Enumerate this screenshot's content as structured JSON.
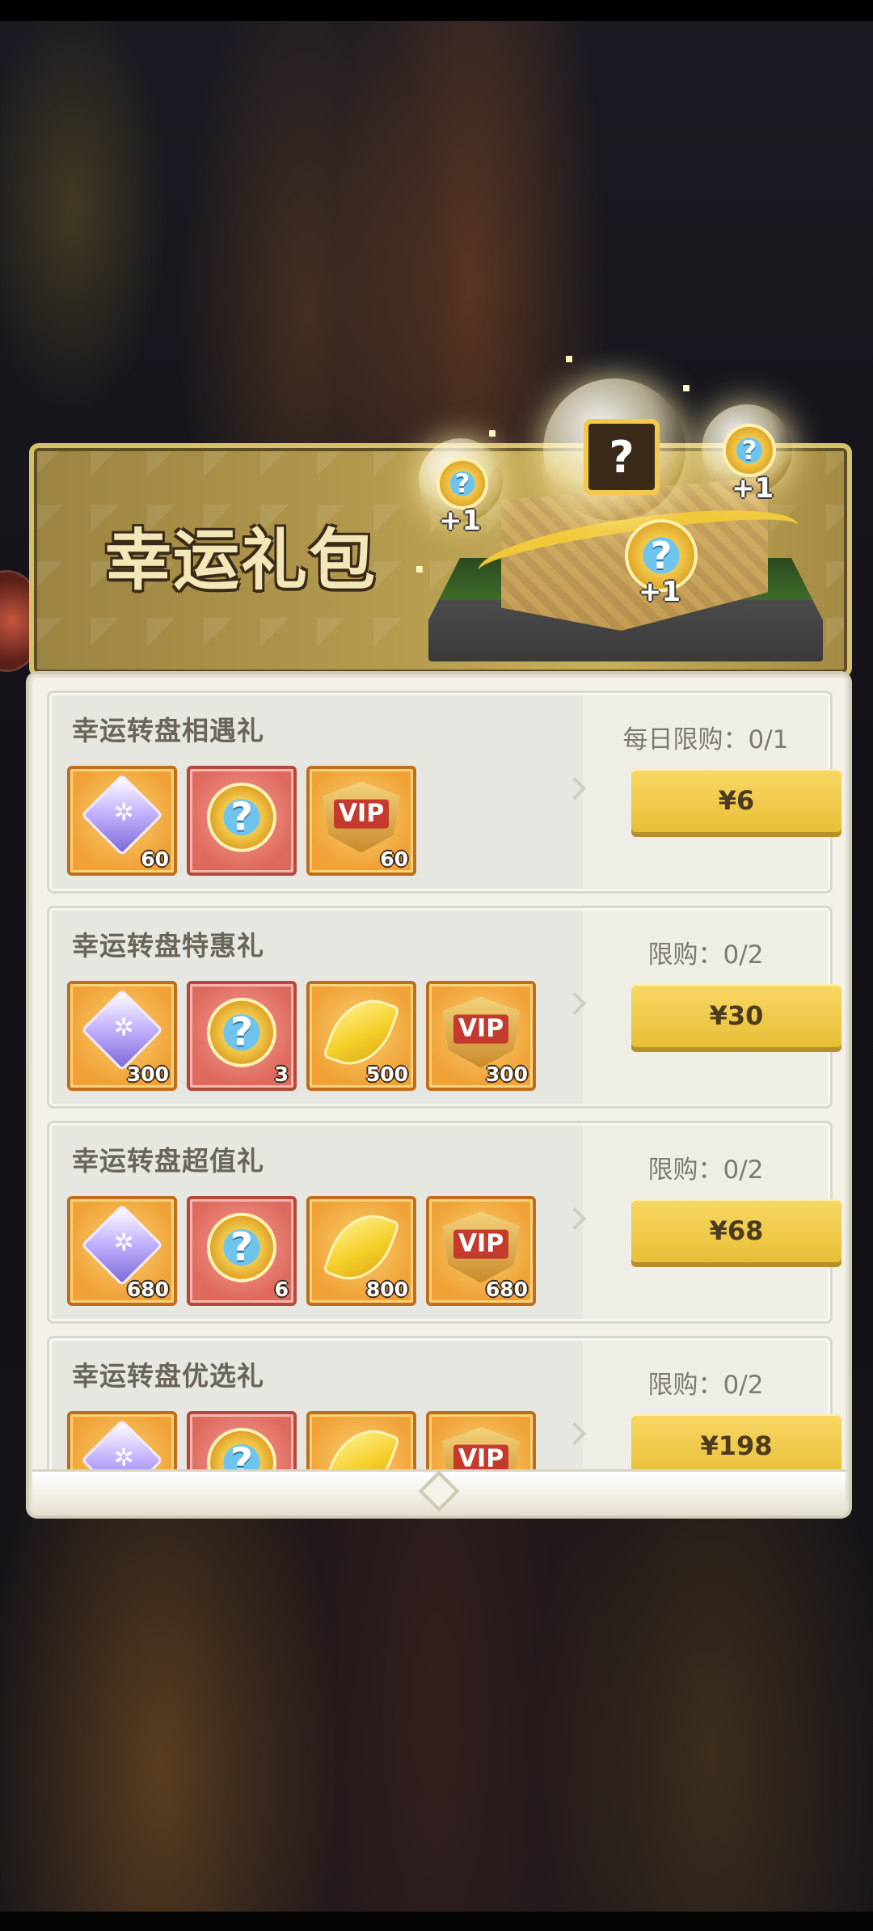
{
  "banner": {
    "title": "幸运礼包",
    "orb_center": "?",
    "plus_labels": [
      "+1",
      "+1",
      "+1"
    ]
  },
  "packs": [
    {
      "title": "幸运转盘相遇礼",
      "limit": "每日限购：0/1",
      "price": "¥6",
      "items": [
        {
          "icon": "diamond-icon",
          "qty": "60",
          "frame": "gold"
        },
        {
          "icon": "lucky-coin-icon",
          "qty": "",
          "frame": "red"
        },
        {
          "icon": "vip-badge-icon",
          "qty": "60",
          "frame": "gold"
        }
      ]
    },
    {
      "title": "幸运转盘特惠礼",
      "limit": "限购：0/2",
      "price": "¥30",
      "items": [
        {
          "icon": "diamond-icon",
          "qty": "300",
          "frame": "gold"
        },
        {
          "icon": "lucky-coin-icon",
          "qty": "3",
          "frame": "red"
        },
        {
          "icon": "gold-leaf-icon",
          "qty": "500",
          "frame": "gold"
        },
        {
          "icon": "vip-badge-icon",
          "qty": "300",
          "frame": "gold"
        }
      ]
    },
    {
      "title": "幸运转盘超值礼",
      "limit": "限购：0/2",
      "price": "¥68",
      "items": [
        {
          "icon": "diamond-icon",
          "qty": "680",
          "frame": "gold"
        },
        {
          "icon": "lucky-coin-icon",
          "qty": "6",
          "frame": "red"
        },
        {
          "icon": "gold-leaf-icon",
          "qty": "800",
          "frame": "gold"
        },
        {
          "icon": "vip-badge-icon",
          "qty": "680",
          "frame": "gold"
        }
      ]
    },
    {
      "title": "幸运转盘优选礼",
      "limit": "限购：0/2",
      "price": "¥198",
      "items": [
        {
          "icon": "diamond-icon",
          "qty": "",
          "frame": "gold"
        },
        {
          "icon": "lucky-coin-icon",
          "qty": "",
          "frame": "red"
        },
        {
          "icon": "gold-leaf-icon",
          "qty": "",
          "frame": "gold"
        },
        {
          "icon": "vip-badge-icon",
          "qty": "",
          "frame": "gold"
        }
      ]
    }
  ],
  "icon_glyphs": {
    "coin_mark": "?",
    "vip_mark": "VIP",
    "diamond_mark": "✲"
  },
  "colors": {
    "button": "#f2cd4a",
    "panel": "#f3f1e8",
    "gold_frame": "#f0a237",
    "red_frame": "#de6a5d"
  }
}
